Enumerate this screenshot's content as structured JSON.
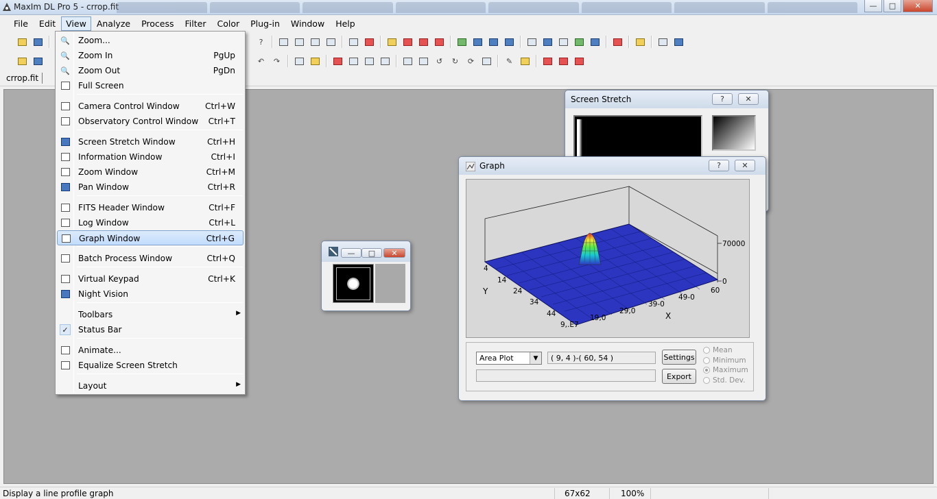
{
  "window": {
    "title": "MaxIm DL Pro 5 - crrop.fit"
  },
  "menubar": [
    "File",
    "Edit",
    "View",
    "Analyze",
    "Process",
    "Filter",
    "Color",
    "Plug-in",
    "Window",
    "Help"
  ],
  "document_tab": "crrop.fit",
  "view_menu": {
    "items": [
      {
        "label": "Zoom...",
        "shortcut": "",
        "icon": "zoom-icon"
      },
      {
        "label": "Zoom In",
        "shortcut": "PgUp",
        "icon": "zoom-in-icon"
      },
      {
        "label": "Zoom Out",
        "shortcut": "PgDn",
        "icon": "zoom-out-icon"
      },
      {
        "label": "Full Screen",
        "shortcut": "",
        "icon": "full-screen-icon"
      },
      {
        "label": "Camera Control Window",
        "shortcut": "Ctrl+W",
        "icon": "camera-icon"
      },
      {
        "label": "Observatory Control Window",
        "shortcut": "Ctrl+T",
        "icon": "observatory-icon"
      },
      {
        "label": "Screen Stretch Window",
        "shortcut": "Ctrl+H",
        "icon": "screen-stretch-icon"
      },
      {
        "label": "Information Window",
        "shortcut": "Ctrl+I",
        "icon": "information-icon"
      },
      {
        "label": "Zoom Window",
        "shortcut": "Ctrl+M",
        "icon": "zoom-window-icon"
      },
      {
        "label": "Pan Window",
        "shortcut": "Ctrl+R",
        "icon": "pan-icon"
      },
      {
        "label": "FITS Header Window",
        "shortcut": "Ctrl+F",
        "icon": "fits-header-icon"
      },
      {
        "label": "Log Window",
        "shortcut": "Ctrl+L",
        "icon": "log-icon"
      },
      {
        "label": "Graph Window",
        "shortcut": "Ctrl+G",
        "icon": "graph-icon"
      },
      {
        "label": "Batch Process Window",
        "shortcut": "Ctrl+Q",
        "icon": "batch-icon"
      },
      {
        "label": "Virtual Keypad",
        "shortcut": "Ctrl+K",
        "icon": "keypad-icon"
      },
      {
        "label": "Night Vision",
        "shortcut": "",
        "icon": "night-vision-icon"
      },
      {
        "label": "Toolbars",
        "shortcut": "",
        "icon": "",
        "submenu": true
      },
      {
        "label": "Status Bar",
        "shortcut": "",
        "icon": "check-icon"
      },
      {
        "label": "Animate...",
        "shortcut": "",
        "icon": "animate-icon"
      },
      {
        "label": "Equalize Screen Stretch",
        "shortcut": "",
        "icon": "equalize-icon"
      },
      {
        "label": "Layout",
        "shortcut": "",
        "icon": "",
        "submenu": true
      }
    ],
    "highlighted": "Graph Window"
  },
  "screen_stretch": {
    "title": "Screen Stretch",
    "help": "?",
    "close": "✕"
  },
  "graph": {
    "title": "Graph",
    "help": "?",
    "close": "✕",
    "plot_type": "Area Plot",
    "range": "( 9, 4 )-( 60, 54 )",
    "settings_label": "Settings",
    "export_label": "Export",
    "options": [
      {
        "label": "Mean",
        "selected": false
      },
      {
        "label": "Minimum",
        "selected": false
      },
      {
        "label": "Maximum",
        "selected": true
      },
      {
        "label": "Std. Dev.",
        "selected": false
      }
    ],
    "axis": {
      "y_label": "Y",
      "x_label": "X",
      "y_ticks": [
        "4",
        "14",
        "24",
        "34",
        "44"
      ],
      "x_ticks": [
        "9,.E7",
        "19,0",
        "29,0",
        "39-0",
        "49-0",
        "60"
      ],
      "z_ticks": [
        "70000",
        "0"
      ]
    }
  },
  "image_window": {
    "min": "—",
    "max": "□",
    "close": "✕"
  },
  "statusbar": {
    "message": "Display a line profile graph",
    "size": "67x62",
    "zoom": "100%"
  }
}
